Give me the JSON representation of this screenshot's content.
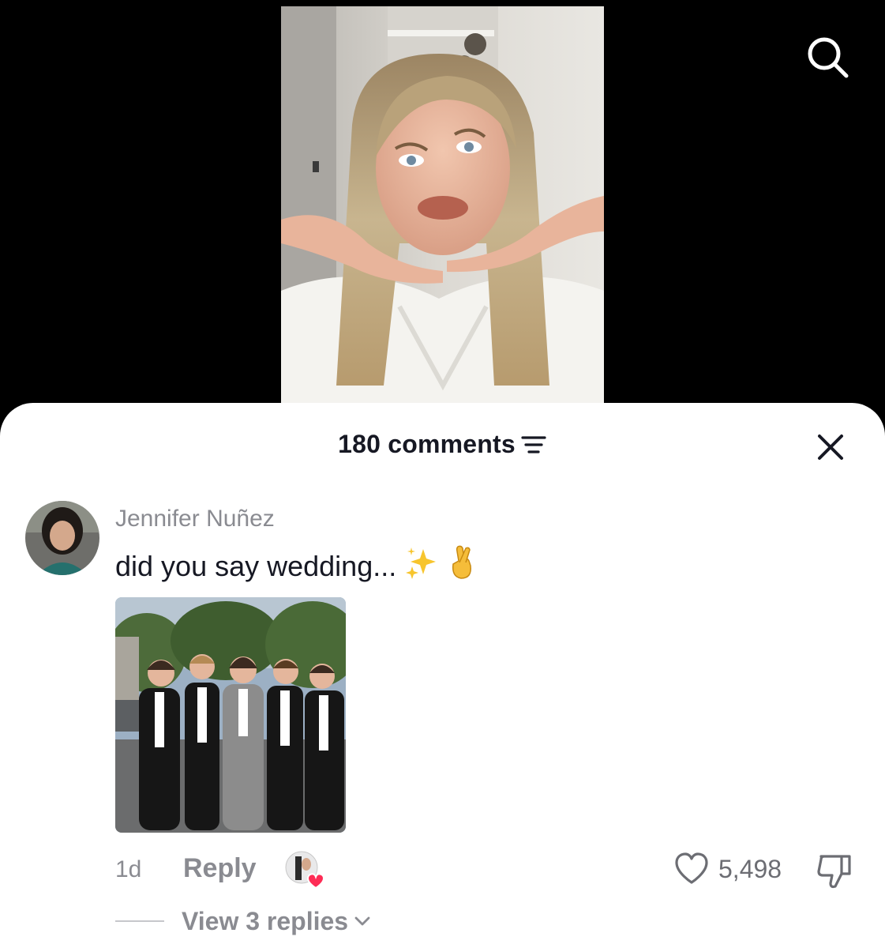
{
  "header": {
    "comment_count_label": "180 comments"
  },
  "comment": {
    "username": "Jennifer Nuñez",
    "text": "did you say wedding...",
    "emojis": [
      "✨",
      "🤞"
    ],
    "age": "1d",
    "reply_label": "Reply",
    "like_count": "5,498",
    "view_replies_label": "View 3 replies"
  },
  "icons": {
    "search": "search-icon",
    "sort": "sort-filter-icon",
    "close": "close-icon",
    "heart": "heart-outline-icon",
    "dislike": "thumbs-down-icon",
    "chevron": "chevron-down-icon",
    "creator_heart": "creator-liked-heart-icon"
  },
  "colors": {
    "primary_text": "#161823",
    "secondary_text": "#8a8b91",
    "creator_heart": "#fe2c55",
    "background": "#ffffff"
  }
}
